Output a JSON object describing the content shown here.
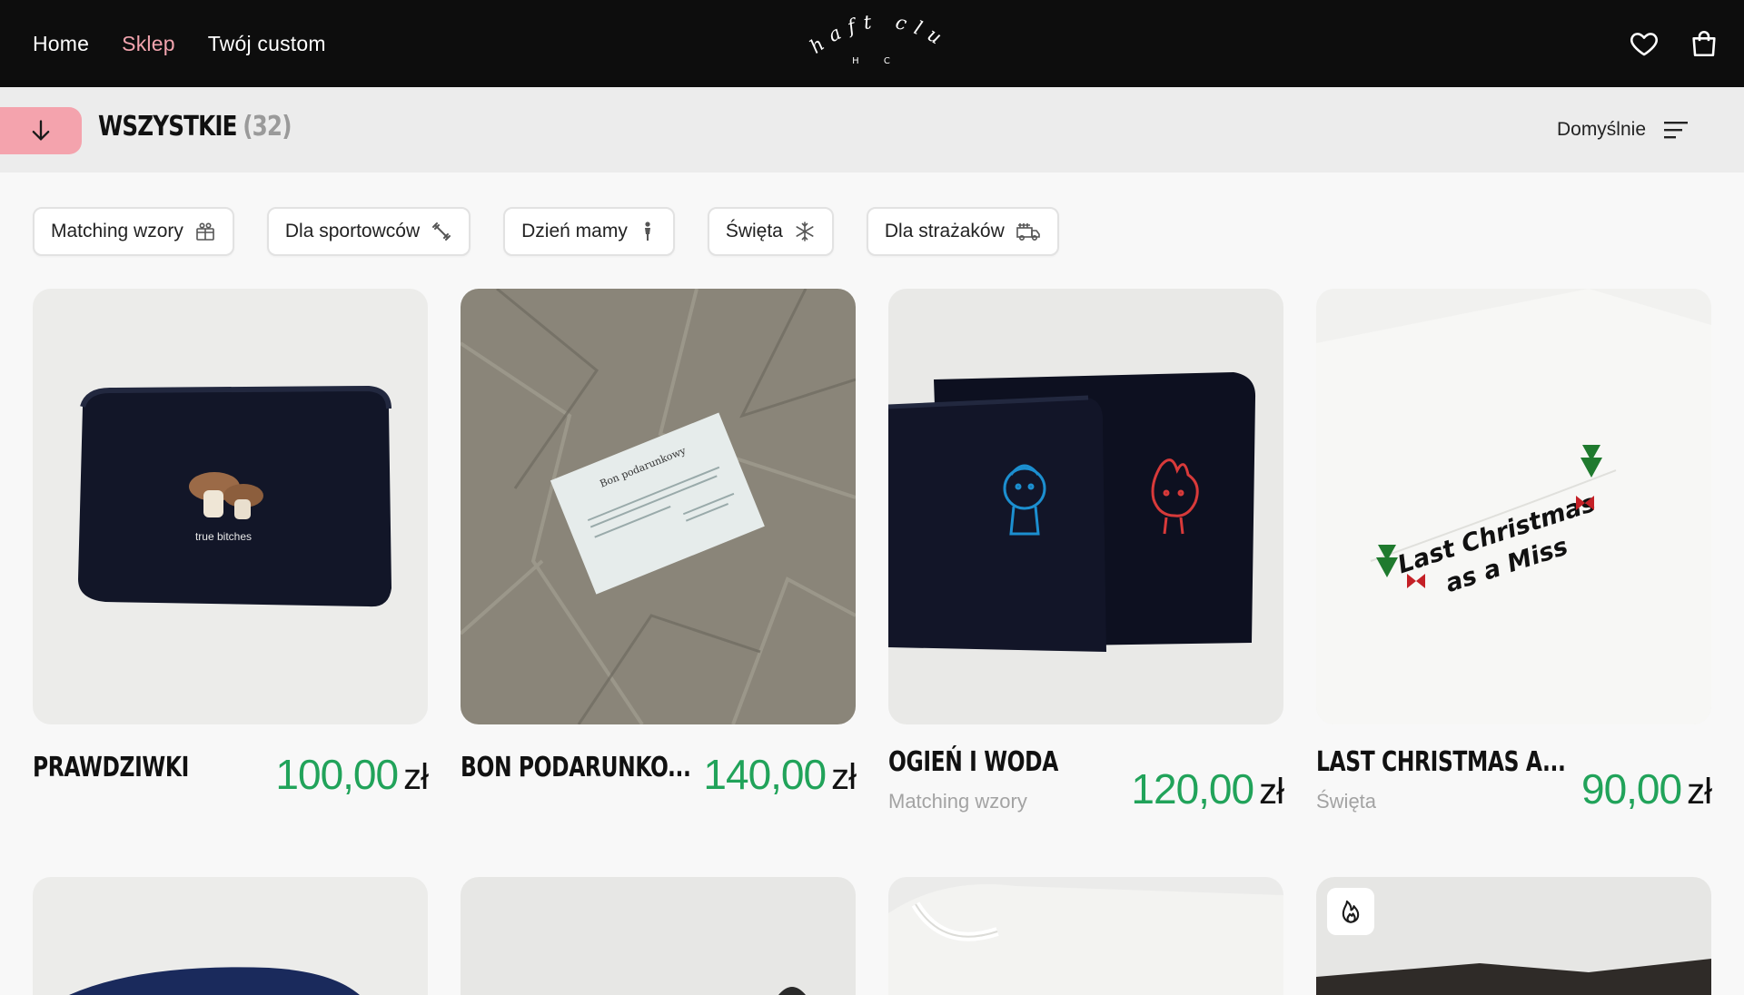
{
  "header": {
    "nav": [
      {
        "label": "Home",
        "active": false
      },
      {
        "label": "Sklep",
        "active": true
      },
      {
        "label": "Twój custom",
        "active": false
      }
    ],
    "logo_text": "haft club",
    "logo_monogram": "H C",
    "icons": [
      "heart-icon",
      "shopping-bag-icon"
    ]
  },
  "category": {
    "title": "WSZYSTKIE",
    "count": "(32)",
    "sort_label": "Domyślnie"
  },
  "filters": [
    {
      "label": "Matching wzory",
      "icon": "gift-icon"
    },
    {
      "label": "Dla sportowców",
      "icon": "dumbbell-icon"
    },
    {
      "label": "Dzień mamy",
      "icon": "person-icon"
    },
    {
      "label": "Święta",
      "icon": "snowflake-icon"
    },
    {
      "label": "Dla strażaków",
      "icon": "fire-truck-icon"
    }
  ],
  "products": [
    {
      "name": "PRAWDZIWKI",
      "category": "",
      "price": "100,00",
      "currency": "zł",
      "image_text": "true bitches"
    },
    {
      "name": "BON PODARUNKO...",
      "category": "",
      "price": "140,00",
      "currency": "zł",
      "image_text": "Bon podarunkowy"
    },
    {
      "name": "OGIEŃ I WODA",
      "category": "Matching wzory",
      "price": "120,00",
      "currency": "zł",
      "image_text": ""
    },
    {
      "name": "LAST CHRISTMAS A...",
      "category": "Święta",
      "price": "90,00",
      "currency": "zł",
      "image_text_line1": "Last Christmas",
      "image_text_line2": "as a Miss"
    }
  ],
  "colors": {
    "accent_pink": "#f4a3ad",
    "price_green": "#21a35a",
    "topbar": "#0d0d0d"
  }
}
